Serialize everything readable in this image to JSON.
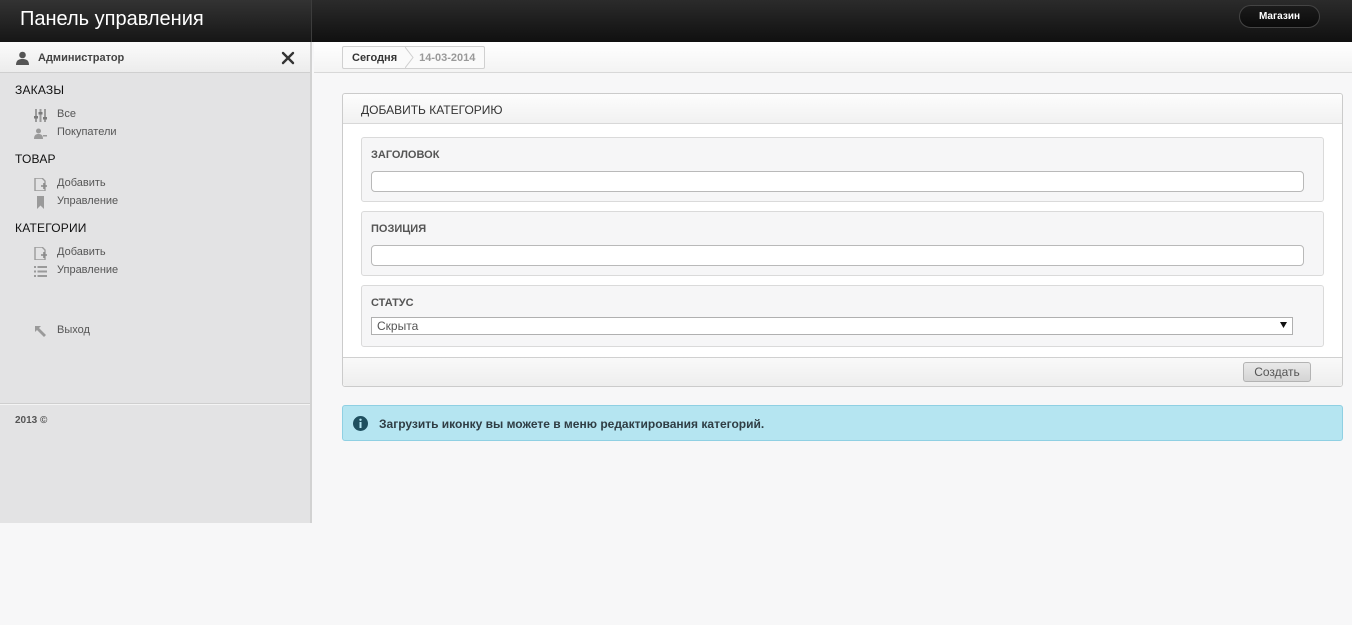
{
  "header": {
    "title": "Панель управления",
    "shop_button": "Магазин"
  },
  "sidebar": {
    "user": "Администратор",
    "sections": [
      {
        "title": "ЗАКАЗЫ",
        "items": [
          {
            "label": "Все",
            "icon": "orders-all-icon"
          },
          {
            "label": "Покупатели",
            "icon": "customers-icon"
          }
        ]
      },
      {
        "title": "ТОВАР",
        "items": [
          {
            "label": "Добавить",
            "icon": "add-document-icon"
          },
          {
            "label": "Управление",
            "icon": "bookmark-icon"
          }
        ]
      },
      {
        "title": "КАТЕГОРИИ",
        "items": [
          {
            "label": "Добавить",
            "icon": "add-document-icon"
          },
          {
            "label": "Управление",
            "icon": "list-icon"
          }
        ]
      }
    ],
    "logout": "Выход",
    "footer": "2013 ©"
  },
  "breadcrumb": {
    "today": "Сегодня",
    "date": "14-03-2014"
  },
  "form": {
    "title": "ДОБАВИТЬ КАТЕГОРИЮ",
    "heading_label": "ЗАГОЛОВОК",
    "heading_value": "",
    "position_label": "ПОЗИЦИЯ",
    "position_value": "",
    "status_label": "СТАТУС",
    "status_selected": "Скрыта",
    "submit": "Создать"
  },
  "alert": {
    "message": "Загрузить иконку вы можете в меню редактирования категорий."
  },
  "colors": {
    "alert_bg": "#b5e5f1",
    "topbar": "#1a1a1a",
    "sidebar_bg": "#e3e3e4"
  }
}
